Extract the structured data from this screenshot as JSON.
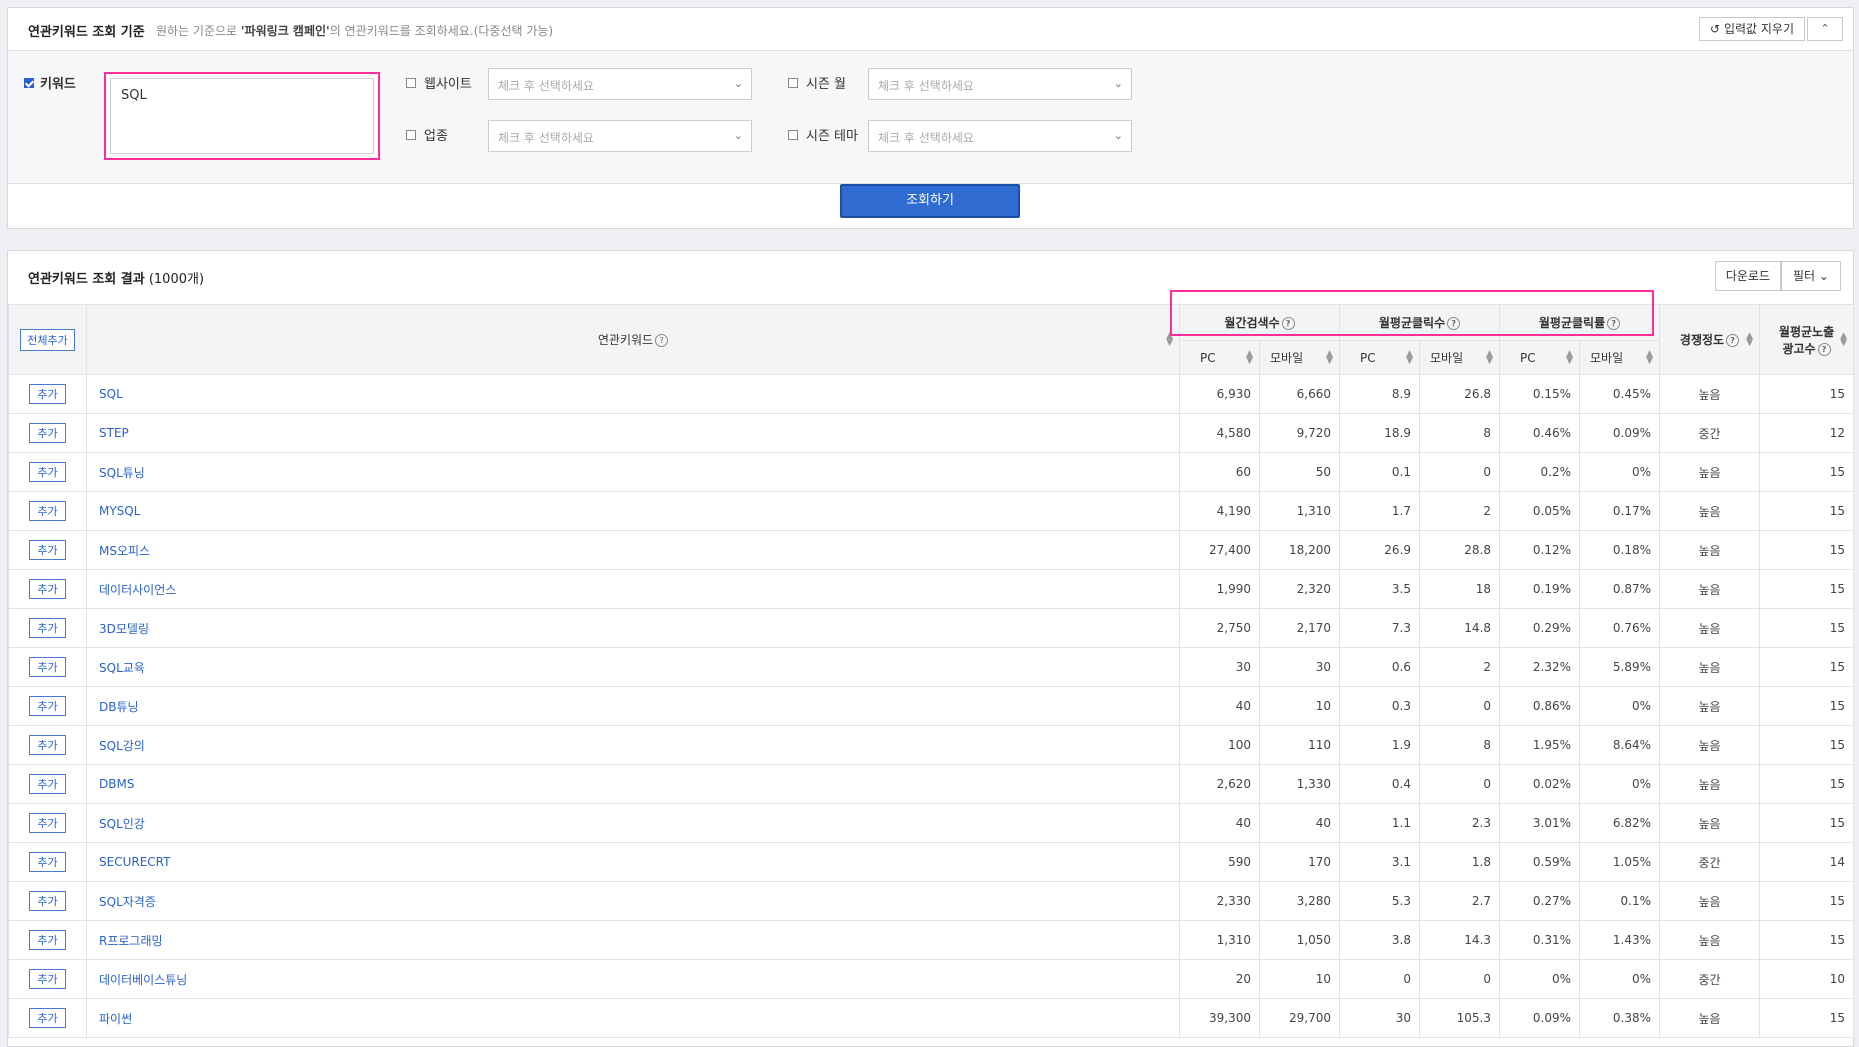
{
  "criteria": {
    "title": "연관키워드 조회 기준",
    "desc_prefix": "원하는 기준으로 ",
    "desc_bold": "'파워링크 캠페인'",
    "desc_suffix": "의 연관키워드를 조회하세요.(다중선택 가능)",
    "reset_label": "입력값 지우기",
    "collapse_label": "⌃",
    "keyword_label": "키워드",
    "keyword_value": "SQL",
    "website_label": "웹사이트",
    "industry_label": "업종",
    "season_month_label": "시즌 월",
    "season_theme_label": "시즌 테마",
    "select_placeholder": "체크 후 선택하세요",
    "search_button": "조회하기"
  },
  "results": {
    "title": "연관키워드 조회 결과",
    "count": "(1000개)",
    "download_label": "다운로드",
    "filter_label": "필터",
    "add_all_label": "전체추가",
    "add_label": "추가",
    "headers": {
      "keyword": "연관키워드",
      "monthly_search": "월간검색수",
      "monthly_clicks": "월평균클릭수",
      "monthly_ctr": "월평균클릭률",
      "competition": "경쟁정도",
      "ad_count_line1": "월평균노출",
      "ad_count_line2": "광고수",
      "pc": "PC",
      "mobile": "모바일"
    },
    "rows": [
      {
        "kw": "SQL",
        "s_pc": "6,930",
        "s_mo": "6,660",
        "c_pc": "8.9",
        "c_mo": "26.8",
        "r_pc": "0.15%",
        "r_mo": "0.45%",
        "comp": "높음",
        "ads": "15"
      },
      {
        "kw": "STEP",
        "s_pc": "4,580",
        "s_mo": "9,720",
        "c_pc": "18.9",
        "c_mo": "8",
        "r_pc": "0.46%",
        "r_mo": "0.09%",
        "comp": "중간",
        "ads": "12"
      },
      {
        "kw": "SQL튜닝",
        "s_pc": "60",
        "s_mo": "50",
        "c_pc": "0.1",
        "c_mo": "0",
        "r_pc": "0.2%",
        "r_mo": "0%",
        "comp": "높음",
        "ads": "15"
      },
      {
        "kw": "MYSQL",
        "s_pc": "4,190",
        "s_mo": "1,310",
        "c_pc": "1.7",
        "c_mo": "2",
        "r_pc": "0.05%",
        "r_mo": "0.17%",
        "comp": "높음",
        "ads": "15"
      },
      {
        "kw": "MS오피스",
        "s_pc": "27,400",
        "s_mo": "18,200",
        "c_pc": "26.9",
        "c_mo": "28.8",
        "r_pc": "0.12%",
        "r_mo": "0.18%",
        "comp": "높음",
        "ads": "15"
      },
      {
        "kw": "데이터사이언스",
        "s_pc": "1,990",
        "s_mo": "2,320",
        "c_pc": "3.5",
        "c_mo": "18",
        "r_pc": "0.19%",
        "r_mo": "0.87%",
        "comp": "높음",
        "ads": "15"
      },
      {
        "kw": "3D모델링",
        "s_pc": "2,750",
        "s_mo": "2,170",
        "c_pc": "7.3",
        "c_mo": "14.8",
        "r_pc": "0.29%",
        "r_mo": "0.76%",
        "comp": "높음",
        "ads": "15"
      },
      {
        "kw": "SQL교육",
        "s_pc": "30",
        "s_mo": "30",
        "c_pc": "0.6",
        "c_mo": "2",
        "r_pc": "2.32%",
        "r_mo": "5.89%",
        "comp": "높음",
        "ads": "15"
      },
      {
        "kw": "DB튜닝",
        "s_pc": "40",
        "s_mo": "10",
        "c_pc": "0.3",
        "c_mo": "0",
        "r_pc": "0.86%",
        "r_mo": "0%",
        "comp": "높음",
        "ads": "15"
      },
      {
        "kw": "SQL강의",
        "s_pc": "100",
        "s_mo": "110",
        "c_pc": "1.9",
        "c_mo": "8",
        "r_pc": "1.95%",
        "r_mo": "8.64%",
        "comp": "높음",
        "ads": "15"
      },
      {
        "kw": "DBMS",
        "s_pc": "2,620",
        "s_mo": "1,330",
        "c_pc": "0.4",
        "c_mo": "0",
        "r_pc": "0.02%",
        "r_mo": "0%",
        "comp": "높음",
        "ads": "15"
      },
      {
        "kw": "SQL인강",
        "s_pc": "40",
        "s_mo": "40",
        "c_pc": "1.1",
        "c_mo": "2.3",
        "r_pc": "3.01%",
        "r_mo": "6.82%",
        "comp": "높음",
        "ads": "15"
      },
      {
        "kw": "SECURECRT",
        "s_pc": "590",
        "s_mo": "170",
        "c_pc": "3.1",
        "c_mo": "1.8",
        "r_pc": "0.59%",
        "r_mo": "1.05%",
        "comp": "중간",
        "ads": "14"
      },
      {
        "kw": "SQL자격증",
        "s_pc": "2,330",
        "s_mo": "3,280",
        "c_pc": "5.3",
        "c_mo": "2.7",
        "r_pc": "0.27%",
        "r_mo": "0.1%",
        "comp": "높음",
        "ads": "15"
      },
      {
        "kw": "R프로그래밍",
        "s_pc": "1,310",
        "s_mo": "1,050",
        "c_pc": "3.8",
        "c_mo": "14.3",
        "r_pc": "0.31%",
        "r_mo": "1.43%",
        "comp": "높음",
        "ads": "15"
      },
      {
        "kw": "데이터베이스튜닝",
        "s_pc": "20",
        "s_mo": "10",
        "c_pc": "0",
        "c_mo": "0",
        "r_pc": "0%",
        "r_mo": "0%",
        "comp": "중간",
        "ads": "10"
      },
      {
        "kw": "파이썬",
        "s_pc": "39,300",
        "s_mo": "29,700",
        "c_pc": "30",
        "c_mo": "105.3",
        "r_pc": "0.09%",
        "r_mo": "0.38%",
        "comp": "높음",
        "ads": "15"
      }
    ]
  },
  "colors": {
    "accent": "#2f6bd0",
    "highlight": "#ff2d9b",
    "link": "#2a62c9"
  }
}
